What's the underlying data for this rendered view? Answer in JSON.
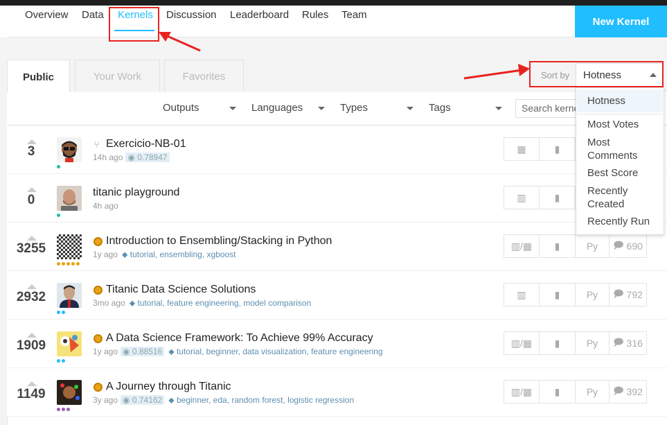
{
  "nav": {
    "items": [
      "Overview",
      "Data",
      "Kernels",
      "Discussion",
      "Leaderboard",
      "Rules",
      "Team"
    ],
    "active": "Kernels",
    "new_kernel": "New Kernel"
  },
  "tabs": [
    "Public",
    "Your Work",
    "Favorites"
  ],
  "filters": [
    "Outputs",
    "Languages",
    "Types",
    "Tags"
  ],
  "search": {
    "placeholder": "Search kernels"
  },
  "sort": {
    "label": "Sort by",
    "selected": "Hotness",
    "options": [
      "Hotness",
      "Most Votes",
      "Most Comments",
      "Best Score",
      "Recently Created",
      "Recently Run"
    ]
  },
  "kernels": [
    {
      "votes": "3",
      "title": "Exercicio-NB-01",
      "time": "14h ago",
      "score": "0.78947",
      "tags": "",
      "lang": "",
      "comments": "",
      "icon": "fork-icon"
    },
    {
      "votes": "0",
      "title": "titanic playground",
      "time": "4h ago",
      "score": "",
      "tags": "",
      "lang": "",
      "comments": "",
      "icon": ""
    },
    {
      "votes": "3255",
      "title": "Introduction to Ensembling/Stacking in Python",
      "time": "1y ago",
      "score": "",
      "tags": "tutorial, ensembling, xgboost",
      "lang": "Py",
      "comments": "690",
      "icon": "gold-medal-icon"
    },
    {
      "votes": "2932",
      "title": "Titanic Data Science Solutions",
      "time": "3mo ago",
      "score": "",
      "tags": "tutorial, feature engineering, model comparison",
      "lang": "Py",
      "comments": "792",
      "icon": "gold-medal-icon"
    },
    {
      "votes": "1909",
      "title": "A Data Science Framework: To Achieve 99% Accuracy",
      "time": "1y ago",
      "score": "0.88516",
      "tags": "tutorial, beginner, data visualization, feature engineering",
      "lang": "Py",
      "comments": "316",
      "icon": "gold-medal-icon"
    },
    {
      "votes": "1149",
      "title": "A Journey through Titanic",
      "time": "3y ago",
      "score": "0.74162",
      "tags": "beginner, eda, random forest, logistic regression",
      "lang": "Py",
      "comments": "392",
      "icon": "gold-medal-icon"
    }
  ],
  "colors": {
    "accent": "#20beff",
    "annotation_red": "#e8231f",
    "medal": "#e8a317",
    "tag": "#5d8fb0"
  }
}
